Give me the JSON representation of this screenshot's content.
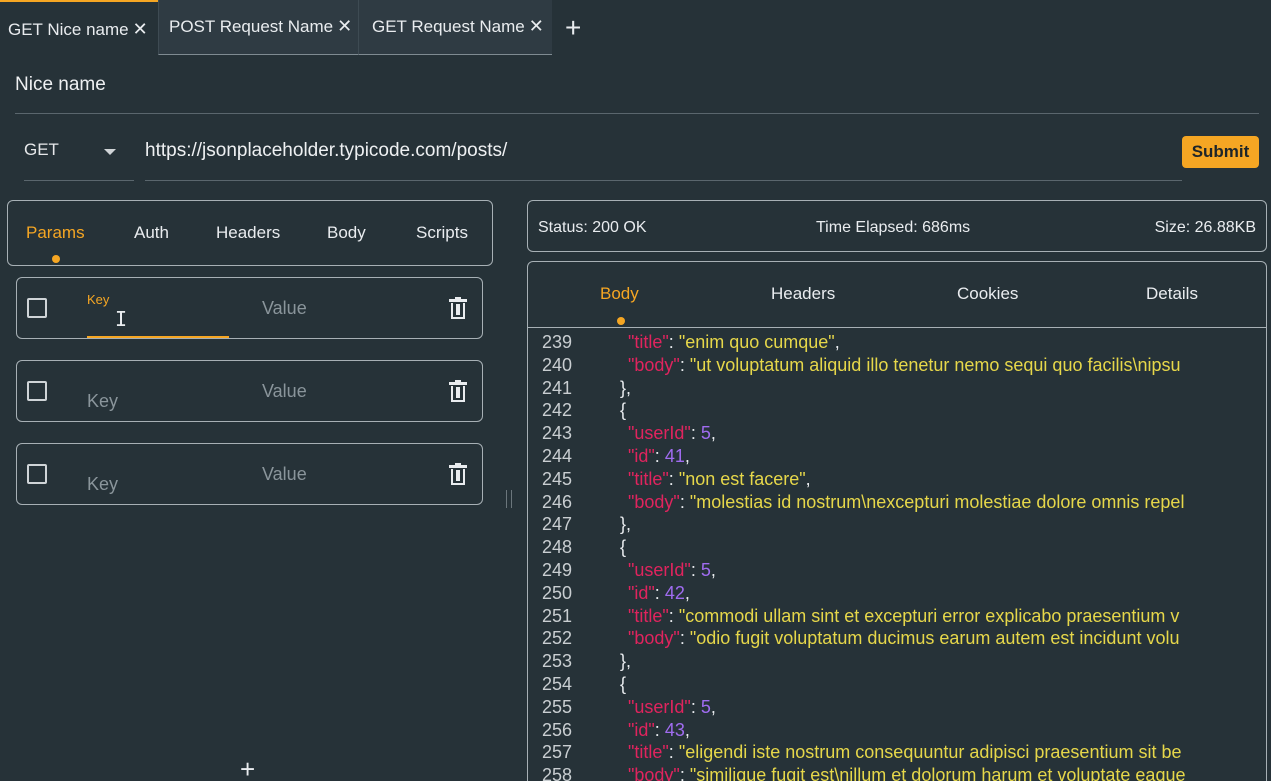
{
  "tabs": [
    {
      "label": "GET Nice name",
      "active": true
    },
    {
      "label": "POST Request Name",
      "active": false
    },
    {
      "label": "GET Request Name",
      "active": false
    }
  ],
  "tab_close_glyph": "✕",
  "tab_add_glyph": "+",
  "request": {
    "name": "Nice name",
    "method": "GET",
    "url": "https://jsonplaceholder.typicode.com/posts/",
    "submit_label": "Submit"
  },
  "request_tabs": [
    "Params",
    "Auth",
    "Headers",
    "Body",
    "Scripts"
  ],
  "params": {
    "key_label": "Key",
    "key_placeholder": "Key",
    "value_placeholder": "Value",
    "rows": 3,
    "add_glyph": "+"
  },
  "status": {
    "status": "Status: 200 OK",
    "time": "Time Elapsed: 686ms",
    "size": "Size: 26.88KB"
  },
  "response_tabs": [
    "Body",
    "Headers",
    "Cookies",
    "Details"
  ],
  "response_body_lines": [
    {
      "n": "239",
      "indent": 1,
      "key": "title",
      "type": "s",
      "value": "enim quo cumque",
      "comma": true
    },
    {
      "n": "240",
      "indent": 1,
      "key": "body",
      "type": "s",
      "value": "ut voluptatum aliquid illo tenetur nemo sequi quo facilis\\nipsu",
      "comma": false
    },
    {
      "n": "241",
      "indent": 0,
      "raw": "},"
    },
    {
      "n": "242",
      "indent": 0,
      "raw": "{"
    },
    {
      "n": "243",
      "indent": 1,
      "key": "userId",
      "type": "n",
      "value": "5",
      "comma": true
    },
    {
      "n": "244",
      "indent": 1,
      "key": "id",
      "type": "n",
      "value": "41",
      "comma": true
    },
    {
      "n": "245",
      "indent": 1,
      "key": "title",
      "type": "s",
      "value": "non est facere",
      "comma": true
    },
    {
      "n": "246",
      "indent": 1,
      "key": "body",
      "type": "s",
      "value": "molestias id nostrum\\nexcepturi molestiae dolore omnis repel",
      "comma": false
    },
    {
      "n": "247",
      "indent": 0,
      "raw": "},"
    },
    {
      "n": "248",
      "indent": 0,
      "raw": "{"
    },
    {
      "n": "249",
      "indent": 1,
      "key": "userId",
      "type": "n",
      "value": "5",
      "comma": true
    },
    {
      "n": "250",
      "indent": 1,
      "key": "id",
      "type": "n",
      "value": "42",
      "comma": true
    },
    {
      "n": "251",
      "indent": 1,
      "key": "title",
      "type": "s",
      "value": "commodi ullam sint et excepturi error explicabo praesentium v",
      "comma": false
    },
    {
      "n": "252",
      "indent": 1,
      "key": "body",
      "type": "s",
      "value": "odio fugit voluptatum ducimus earum autem est incidunt volu",
      "comma": false
    },
    {
      "n": "253",
      "indent": 0,
      "raw": "},"
    },
    {
      "n": "254",
      "indent": 0,
      "raw": "{"
    },
    {
      "n": "255",
      "indent": 1,
      "key": "userId",
      "type": "n",
      "value": "5",
      "comma": true
    },
    {
      "n": "256",
      "indent": 1,
      "key": "id",
      "type": "n",
      "value": "43",
      "comma": true
    },
    {
      "n": "257",
      "indent": 1,
      "key": "title",
      "type": "s",
      "value": "eligendi iste nostrum consequuntur adipisci praesentium sit be",
      "comma": false
    },
    {
      "n": "258",
      "indent": 1,
      "key": "body",
      "type": "s",
      "value": "similique fugit est\\nillum et dolorum harum et voluptate eaque",
      "comma": false
    }
  ],
  "colors": {
    "accent": "#f5a623",
    "background": "#263238",
    "json_key": "#e0245e",
    "json_string": "#e6d74a",
    "json_number": "#a06cf0"
  }
}
